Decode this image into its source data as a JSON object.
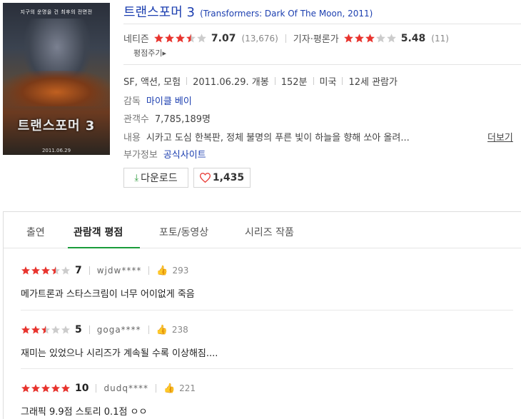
{
  "poster": {
    "tagline": "지구의 운명을 건 최후의 전면전",
    "title_art": "트랜스포머 3",
    "date_art": "2011.06.29"
  },
  "movie": {
    "title_ko": "트랜스포머 3",
    "title_en": "(Transformers: Dark Of The Moon, 2011)",
    "netizen_label": "네티즌",
    "netizen_score": "7.07",
    "netizen_stars": 3.5,
    "netizen_count": "(13,676)",
    "critic_label": "기자·평론가",
    "critic_score": "5.48",
    "critic_stars": 3,
    "critic_count": "(11)",
    "rate_link": "평점주기▸",
    "genre": "SF, 액션, 모험",
    "release": "2011.06.29. 개봉",
    "runtime": "152분",
    "country": "미국",
    "age": "12세 관람가",
    "director_label": "감독",
    "director": "마이클 베이",
    "audience_label": "관객수",
    "audience": "7,785,189명",
    "content_label": "내용",
    "content": "시카고 도심 한복판, 정체 불명의 푸른 빛이 하늘을 향해 쏘아 올려...",
    "more_link": "더보기",
    "extra_label": "부가정보",
    "extra_link": "공식사이트"
  },
  "buttons": {
    "download": "다운로드",
    "like_count": "1,435"
  },
  "tabs": [
    "출연",
    "관람객 평점",
    "포토/동영상",
    "시리즈 작품"
  ],
  "active_tab": "관람객 평점",
  "reviews": [
    {
      "stars": 3.5,
      "score": "7",
      "user": "wjdw****",
      "likes": "293",
      "text": "메가트론과 스타스크림이 너무 어이없게 죽음"
    },
    {
      "stars": 2.5,
      "score": "5",
      "user": "goga****",
      "likes": "238",
      "text": "재미는 있었으나 시리즈가 계속될 수록 이상해짐...."
    },
    {
      "stars": 5,
      "score": "10",
      "user": "dudq****",
      "likes": "221",
      "text": "그래픽 9.9점 스토리 0.1점 ㅇㅇ"
    }
  ],
  "colors": {
    "star_on": "#e8342e",
    "star_off": "#cccccc",
    "link": "#1c3fb0",
    "tab_accent": "#1a9c3a"
  }
}
